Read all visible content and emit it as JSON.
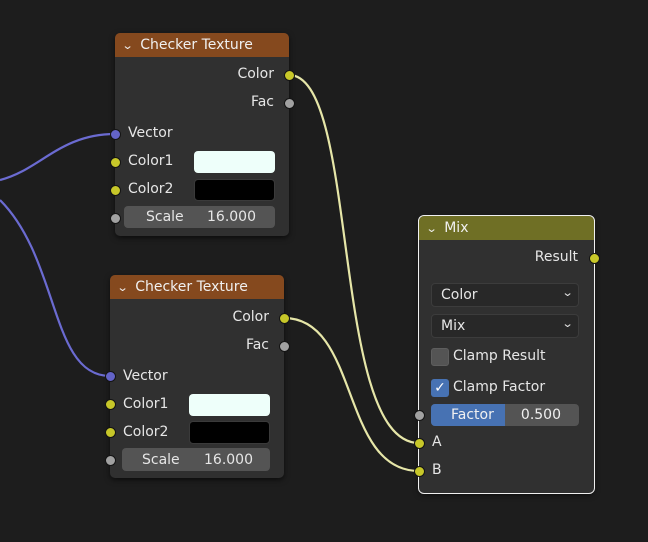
{
  "colors": {
    "background": "#1d1d1d",
    "node_body": "#303030",
    "texture_header": "#85491e",
    "mix_header": "#6f6f25",
    "socket_color": "#c7c729",
    "socket_float": "#a1a1a1",
    "socket_vector": "#6363c7",
    "wire_color": "#e6e6a8",
    "wire_vector": "#6b6bd1",
    "accent": "#4772b3"
  },
  "node_checker_1": {
    "title": "Checker Texture",
    "header_icon": "chevron-down-icon",
    "out_color": "Color",
    "out_fac": "Fac",
    "in_vector": "Vector",
    "in_color1": "Color1",
    "color1_value": "#eefffa",
    "in_color2": "Color2",
    "color2_value": "#000000",
    "scale_label": "Scale",
    "scale_value": "16.000"
  },
  "node_checker_2": {
    "title": "Checker Texture",
    "header_icon": "chevron-down-icon",
    "out_color": "Color",
    "out_fac": "Fac",
    "in_vector": "Vector",
    "in_color1": "Color1",
    "color1_value": "#eefffa",
    "in_color2": "Color2",
    "color2_value": "#000000",
    "scale_label": "Scale",
    "scale_value": "16.000"
  },
  "node_mix": {
    "title": "Mix",
    "header_icon": "chevron-down-icon",
    "out_result": "Result",
    "data_type": "Color",
    "blend_mode": "Mix",
    "clamp_result_label": "Clamp Result",
    "clamp_result_checked": false,
    "clamp_factor_label": "Clamp Factor",
    "clamp_factor_checked": true,
    "factor_label": "Factor",
    "factor_value": "0.500",
    "factor_fraction": 0.5,
    "in_a": "A",
    "in_b": "B"
  }
}
